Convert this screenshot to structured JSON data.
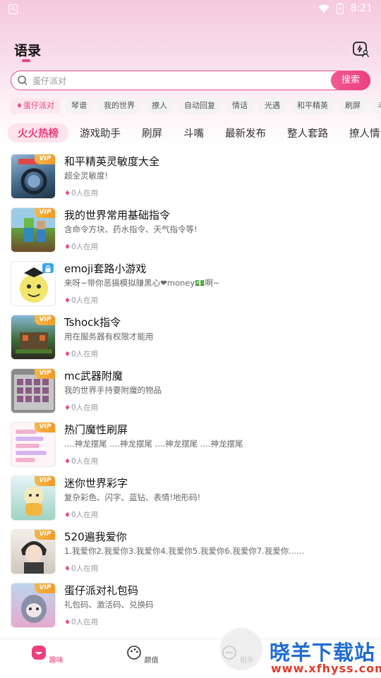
{
  "status": {
    "time": "8:21",
    "left_icon": "A"
  },
  "header": {
    "title": "语录"
  },
  "search": {
    "placeholder": "蛋仔派对",
    "button": "搜索"
  },
  "chips": [
    "蛋仔派对",
    "琴谱",
    "我的世界",
    "撩人",
    "自动回复",
    "情话",
    "光遇",
    "和平精英",
    "刷屏",
    "斗嘴"
  ],
  "tabs": [
    "火火热榜",
    "游戏助手",
    "刷屏",
    "斗嘴",
    "最新发布",
    "整人套路",
    "撩人情话"
  ],
  "items": [
    {
      "title": "和平精英灵敏度大全",
      "desc": "超全灵敏度!",
      "usage": "0人在用",
      "badge": "VIP"
    },
    {
      "title": "我的世界常用基础指令",
      "desc": "含命令方块、药水指令、天气指令等!",
      "usage": "0人在用",
      "badge": "VIP"
    },
    {
      "title": "emoji套路小游戏",
      "desc": "来呀~带你恶搞模拟赚黑心❤money💵啊~",
      "usage": "0人在用",
      "badge": "lock"
    },
    {
      "title": "Tshock指令",
      "desc": "用在服务器有权限才能用",
      "usage": "0人在用",
      "badge": "VIP"
    },
    {
      "title": "mc武器附魔",
      "desc": "我的世界手持要附魔的物品",
      "usage": "0人在用",
      "badge": "VIP"
    },
    {
      "title": "热门魔性刷屏",
      "desc": "....神龙摆尾        ....神龙摆尾        ....神龙摆尾        ....神龙摆尾",
      "usage": "0人在用",
      "badge": "VIP"
    },
    {
      "title": "迷你世界彩字",
      "desc": "复杂彩色、闪字、蓝钻、表情!地形码!",
      "usage": "0人在用",
      "badge": "VIP"
    },
    {
      "title": "520遍我爱你",
      "desc": "1.我爱你2.我爱你3.我爱你4.我爱你5.我爱你6.我爱你7.我爱你......",
      "usage": "0人在用",
      "badge": "VIP"
    },
    {
      "title": "蛋仔派对礼包码",
      "desc": "礼包码、激活码、兑换码",
      "usage": "0人在用",
      "badge": "VIP"
    }
  ],
  "nav": {
    "fun": "趣味",
    "face": "颜值",
    "third": "相亲"
  },
  "watermark": {
    "title": "晓羊下载站",
    "url": "www.xfhyss.com"
  },
  "colors": {
    "accent": "#e63e7b",
    "vip": "#f4a431"
  }
}
